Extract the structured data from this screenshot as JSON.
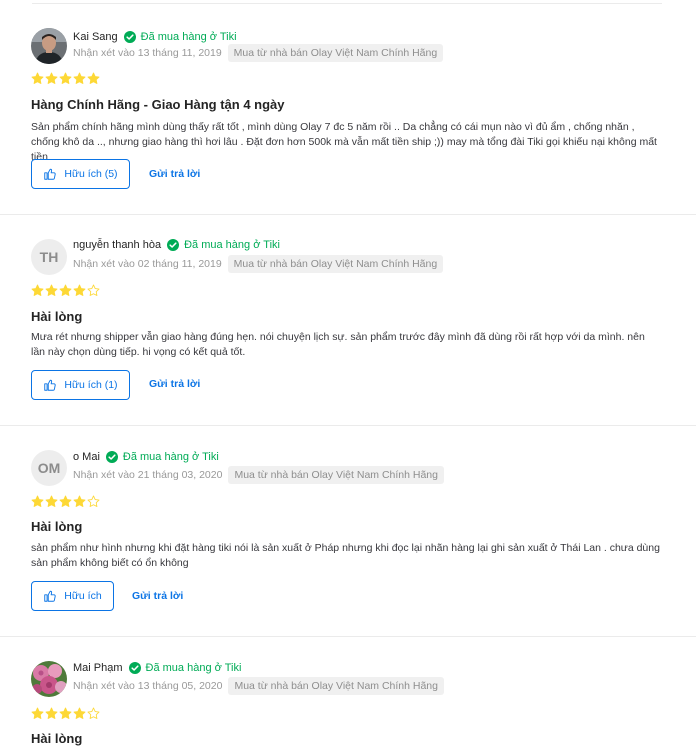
{
  "labels": {
    "verified": "Đã mua hàng ở Tiki",
    "reply": "Gửi trả lời"
  },
  "colors": {
    "verified_green": "#00ab56",
    "star_yellow": "#fdd836",
    "link_blue": "#0b74e5"
  },
  "reviews": [
    {
      "name": "Kai Sang",
      "avatar": "photo-man",
      "date": "Nhận xét vào 13 tháng 11, 2019",
      "seller": "Mua từ nhà bán Olay Việt Nam Chính Hãng",
      "rating": 5,
      "title": "Hàng Chính Hãng - Giao Hàng tận 4 ngày",
      "content": "Sản phẩm chính hãng mình dùng thấy rất tốt , mình dùng Olay 7 đc 5 năm rồi .. Da chẳng có cái mụn nào vì đủ ẩm , chống nhăn , chống khô da .., nhưng giao hàng thì hơi lâu . Đặt đơn hơn 500k mà vẫn mất tiền ship ;)) may mà tổng đài Tiki gọi khiếu nại không mất tiền",
      "helpful": "Hữu ích (5)"
    },
    {
      "name": "nguyễn thanh hòa",
      "avatar": "TH",
      "date": "Nhận xét vào 02 tháng 11, 2019",
      "seller": "Mua từ nhà bán Olay Việt Nam Chính Hãng",
      "rating": 4,
      "title": "Hài lòng",
      "content": "Mưa rét nhưng shipper vẫn giao hàng đúng hẹn. nói chuyện lịch sự. sản phẩm trước đây mình đã dùng rồi rất hợp với da mình. nên lần này chọn dùng tiếp. hi vọng có kết quả tốt.",
      "helpful": "Hữu ích (1)"
    },
    {
      "name": "o Mai",
      "avatar": "OM",
      "date": "Nhận xét vào 21 tháng 03, 2020",
      "seller": "Mua từ nhà bán Olay Việt Nam Chính Hãng",
      "rating": 4,
      "title": "Hài lòng",
      "content": "sản phẩm như hình nhưng khi đặt hàng tiki nói là sản xuất ở Pháp nhưng khi đọc lại nhãn hàng lại ghi sản xuất ở Thái Lan . chưa dùng sản phẩm không biết có ổn không",
      "helpful": "Hữu ích"
    },
    {
      "name": "Mai Phạm",
      "avatar": "photo-flowers",
      "date": "Nhận xét vào 13 tháng 05, 2020",
      "seller": "Mua từ nhà bán Olay Việt Nam Chính Hãng",
      "rating": 4,
      "title": "Hài lòng"
    }
  ]
}
